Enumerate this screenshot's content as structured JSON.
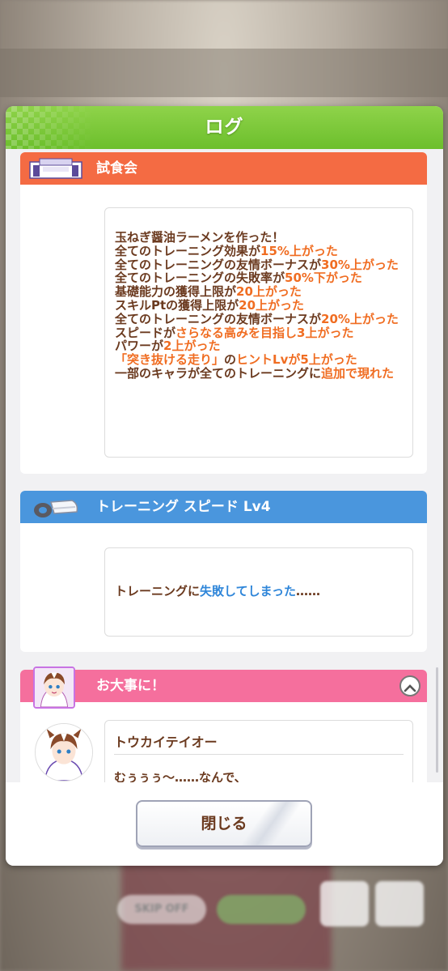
{
  "dialog": {
    "title": "ログ",
    "close_label": "閉じる"
  },
  "background": {
    "skip_label": "SKIP OFF"
  },
  "logs": [
    {
      "title": "試食会",
      "icon": "shop-icon",
      "color": "#f46b43",
      "lines": [
        [
          {
            "t": "玉ねぎ醤油ラーメンを作った！"
          }
        ],
        [
          {
            "t": "全てのトレーニング効果が"
          },
          {
            "t": "15%上がった",
            "h": "o"
          }
        ],
        [
          {
            "t": "全てのトレーニングの友情ボーナスが"
          },
          {
            "t": "30%上がった",
            "h": "o"
          }
        ],
        [
          {
            "t": "全てのトレーニングの失敗率が"
          },
          {
            "t": "50%下がった",
            "h": "o"
          }
        ],
        [
          {
            "t": "基礎能力の獲得上限が"
          },
          {
            "t": "20上がった",
            "h": "o"
          }
        ],
        [
          {
            "t": "スキルPtの獲得上限が"
          },
          {
            "t": "20上がった",
            "h": "o"
          }
        ],
        [
          {
            "t": "全てのトレーニングの友情ボーナスが"
          },
          {
            "t": "20%上がった",
            "h": "o"
          }
        ],
        [
          {
            "t": "スピードが"
          },
          {
            "t": "さらなる高みを目指し3上がった",
            "h": "o"
          }
        ],
        [
          {
            "t": "パワーが"
          },
          {
            "t": "2上がった",
            "h": "o"
          }
        ],
        [
          {
            "t": "「突き抜ける走り」",
            "h": "o"
          },
          {
            "t": "の"
          },
          {
            "t": "ヒントLvが5上がった",
            "h": "o"
          }
        ],
        [
          {
            "t": "一部のキャラが全てのトレーニングに"
          },
          {
            "t": "追加で現れた",
            "h": "o"
          }
        ]
      ]
    },
    {
      "title": "トレーニング スピード Lv4",
      "icon": "running-shoes-icon",
      "color": "#4a96dd",
      "lines": [
        [
          {
            "t": "トレーニングに"
          },
          {
            "t": "失敗してしまった",
            "h": "b"
          },
          {
            "t": "……"
          }
        ]
      ]
    },
    {
      "title": "お大事に！",
      "icon": "character-avatar",
      "color": "#f56f9d",
      "speaker": "トウカイテイオー",
      "text": "むぅぅぅ～……なんで、"
    }
  ]
}
